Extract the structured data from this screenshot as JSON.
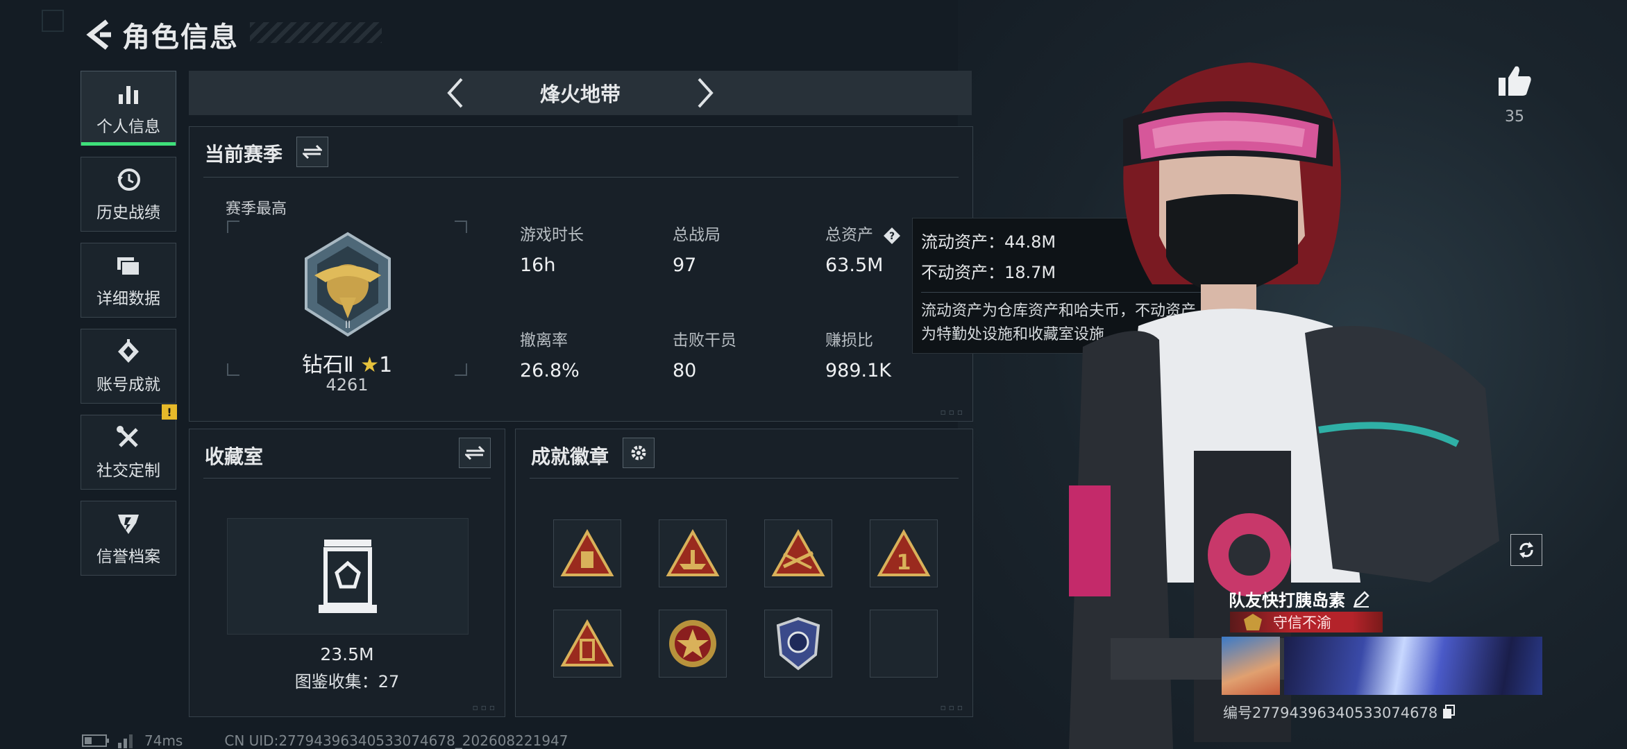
{
  "header": {
    "title": "角色信息"
  },
  "sidebar": {
    "items": [
      {
        "label": "个人信息",
        "icon": "bar-chart-icon",
        "active": true
      },
      {
        "label": "历史战绩",
        "icon": "history-clock-icon"
      },
      {
        "label": "详细数据",
        "icon": "folder-icon"
      },
      {
        "label": "账号成就",
        "icon": "achievement-icon"
      },
      {
        "label": "社交定制",
        "icon": "tools-icon",
        "badge": "!"
      },
      {
        "label": "信誉档案",
        "icon": "reputation-icon"
      }
    ]
  },
  "mode": {
    "title": "烽火地带"
  },
  "season": {
    "title": "当前赛季",
    "best_label": "赛季最高",
    "rank": "钻石Ⅱ",
    "stars": "1",
    "score": "4261",
    "stats": [
      {
        "key": "游戏时长",
        "value": "16h"
      },
      {
        "key": "总战局",
        "value": "97"
      },
      {
        "key": "总资产",
        "value": "63.5M"
      },
      {
        "key": "撤离率",
        "value": "26.8%"
      },
      {
        "key": "击败干员",
        "value": "80"
      },
      {
        "key": "赚损比",
        "value": "989.1K"
      }
    ]
  },
  "tooltip": {
    "liquid": "流动资产：44.8M",
    "fixed": "不动资产：18.7M",
    "desc_line1": "流动资产为仓库资产和哈夫币，不动资产",
    "desc_line2": "为特勤处设施和收藏室设施"
  },
  "collection": {
    "title": "收藏室",
    "value": "23.5M",
    "catalog": "图鉴收集：27"
  },
  "achievements": {
    "title": "成就徽章"
  },
  "player": {
    "likes": "35",
    "name": "队友快打胰岛素",
    "title_tag": "守信不渝",
    "id": "编号2779439634053307467​8"
  },
  "footer": {
    "ping": "74ms",
    "uid": "CN UID:27794396340533074678_202608221947"
  },
  "colors": {
    "accent_green": "#3ee07a",
    "badge_yellow": "#e6b92a",
    "title_red": "#b4232a"
  }
}
